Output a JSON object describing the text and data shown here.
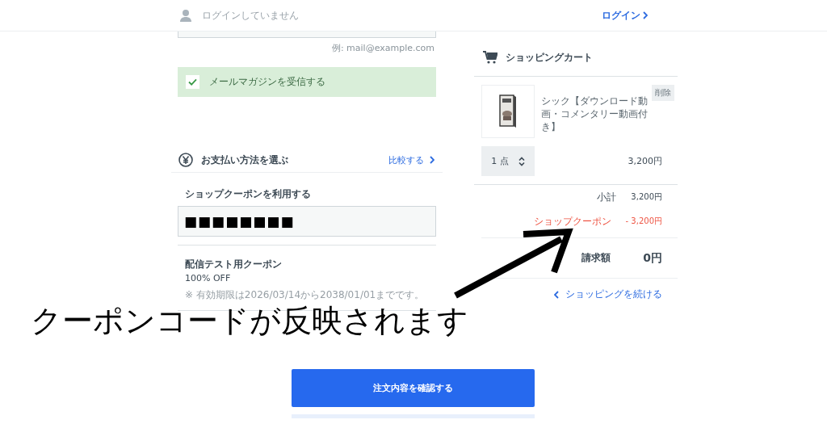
{
  "header": {
    "login_status": "ログインしていません",
    "login_link": "ログイン"
  },
  "email": {
    "hint": "例: mail@example.com"
  },
  "newsletter": {
    "label": "メールマガジンを受信する",
    "checked": true
  },
  "payment": {
    "title": "お支払い方法を選ぶ",
    "compare_link": "比較する"
  },
  "coupon": {
    "label": "ショップクーポンを利用する",
    "value": "■■■■■■■■",
    "name": "配信テスト用クーポン",
    "discount": "100% OFF",
    "validity": "※ 有効期限は2026/03/14から2038/01/01までです。"
  },
  "cart": {
    "title": "ショッピングカート",
    "items": [
      {
        "name": "シック【ダウンロード動画・コメンタリー動画付き】",
        "delete": "削除",
        "quantity": "1 点",
        "price": "3,200円"
      }
    ],
    "subtotal_label": "小計",
    "subtotal": "3,200円",
    "coupon_label": "ショップクーポン",
    "coupon_amount": "- 3,200円",
    "total_label": "請求額",
    "total": "0円",
    "continue_link": "ショッピングを続ける"
  },
  "annotation": {
    "caption": "クーポンコードが反映されます"
  },
  "confirm_button": "注文内容を確認する"
}
